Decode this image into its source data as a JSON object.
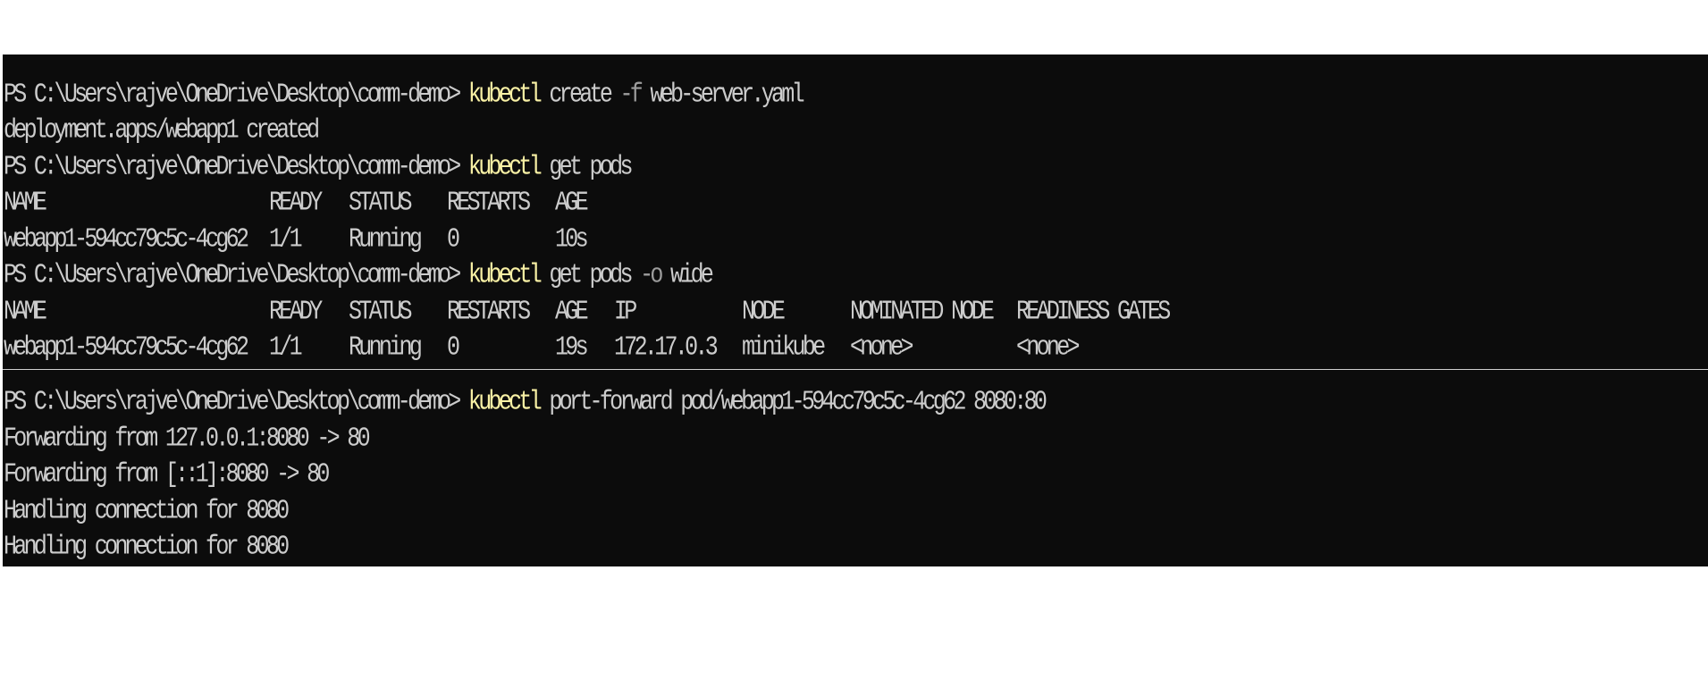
{
  "terminal": {
    "prompt": "PS C:\\Users\\rajve\\OneDrive\\Desktop\\comm-demo> ",
    "cmd1": {
      "exe": "kubectl",
      "args_a": " create ",
      "flag": "-f",
      "args_b": " web-server.yaml"
    },
    "out1": "deployment.apps/webapp1 created",
    "cmd2": {
      "exe": "kubectl",
      "args_a": " get pods"
    },
    "table1": {
      "headers": [
        "NAME",
        "READY",
        "STATUS",
        "RESTARTS",
        "AGE"
      ],
      "row": [
        "webapp1-594cc79c5c-4cg62",
        "1/1",
        "Running",
        "0",
        "10s"
      ]
    },
    "cmd3": {
      "exe": "kubectl",
      "args_a": " get pods ",
      "flag": "-o",
      "args_b": " wide"
    },
    "table2": {
      "headers": [
        "NAME",
        "READY",
        "STATUS",
        "RESTARTS",
        "AGE",
        "IP",
        "NODE",
        "NOMINATED NODE",
        "READINESS GATES"
      ],
      "row": [
        "webapp1-594cc79c5c-4cg62",
        "1/1",
        "Running",
        "0",
        "19s",
        "172.17.0.3",
        "minikube",
        "<none>",
        "<none>"
      ]
    },
    "cmd4": {
      "exe": "kubectl",
      "args_a": " port-forward pod/webapp1-594cc79c5c-4cg62 8080:80"
    },
    "out4": [
      "Forwarding from 127.0.0.1:8080 -> 80",
      "Forwarding from [::1]:8080 -> 80",
      "Handling connection for 8080",
      "Handling connection for 8080"
    ],
    "colors": {
      "background": "#0c0c0c",
      "text": "#cccccc",
      "command": "#f9f1a5",
      "flag": "#9d9d9d"
    }
  }
}
